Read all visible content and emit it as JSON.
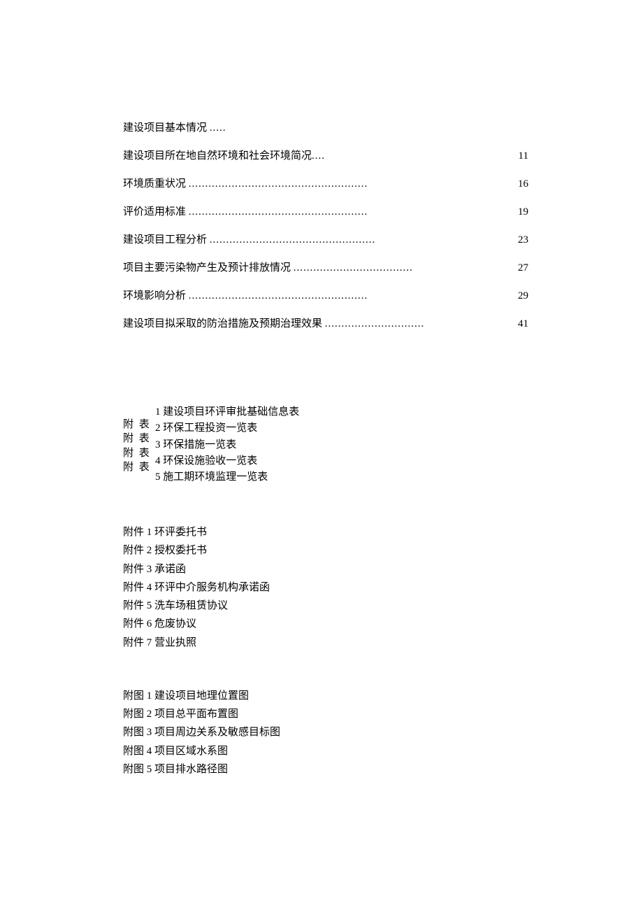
{
  "toc": [
    {
      "title": "建设项目基本情况",
      "dots": ".....",
      "page": ""
    },
    {
      "title": "建设项目所在地自然环境和社会环境简况",
      "dots": "....",
      "page": "11",
      "noDotsSpread": true
    },
    {
      "title": "环境质重状况",
      "dots": "......................................................",
      "page": "16"
    },
    {
      "title": "评价适用标准",
      "dots": "......................................................",
      "page": "19"
    },
    {
      "title": "建设项目工程分析",
      "dots": "..................................................",
      "page": "23"
    },
    {
      "title": "项目主要污染物产生及预计排放情况",
      "dots": "....................................",
      "page": "27"
    },
    {
      "title": "环境影响分析",
      "dots": "......................................................",
      "page": "29"
    },
    {
      "title": "建设项目拟采取的防治措施及预期治理效果",
      "dots": "..............................",
      "page": "41"
    }
  ],
  "fubiao_label": "附 表",
  "fubiao": [
    "1 建设项目环评审批基础信息表",
    "2 环保工程投资一览表",
    "3 环保措施一览表",
    "4 环保设施验收一览表",
    "5 施工期环境监理一览表"
  ],
  "fujian": [
    "附件 1 环评委托书",
    "附件 2 授权委托书",
    "附件 3 承诺函",
    "附件 4 环评中介服务机构承诺函",
    "附件 5 洗车场租赁协议",
    "附件 6 危废协议",
    "附件 7 营业执照"
  ],
  "futu": [
    "附图 1 建设项目地理位置图",
    "附图 2 项目总平面布置图",
    "附图 3 项目周边关系及敏感目标图",
    "附图 4 项目区域水系图",
    "附图 5 项目排水路径图"
  ]
}
